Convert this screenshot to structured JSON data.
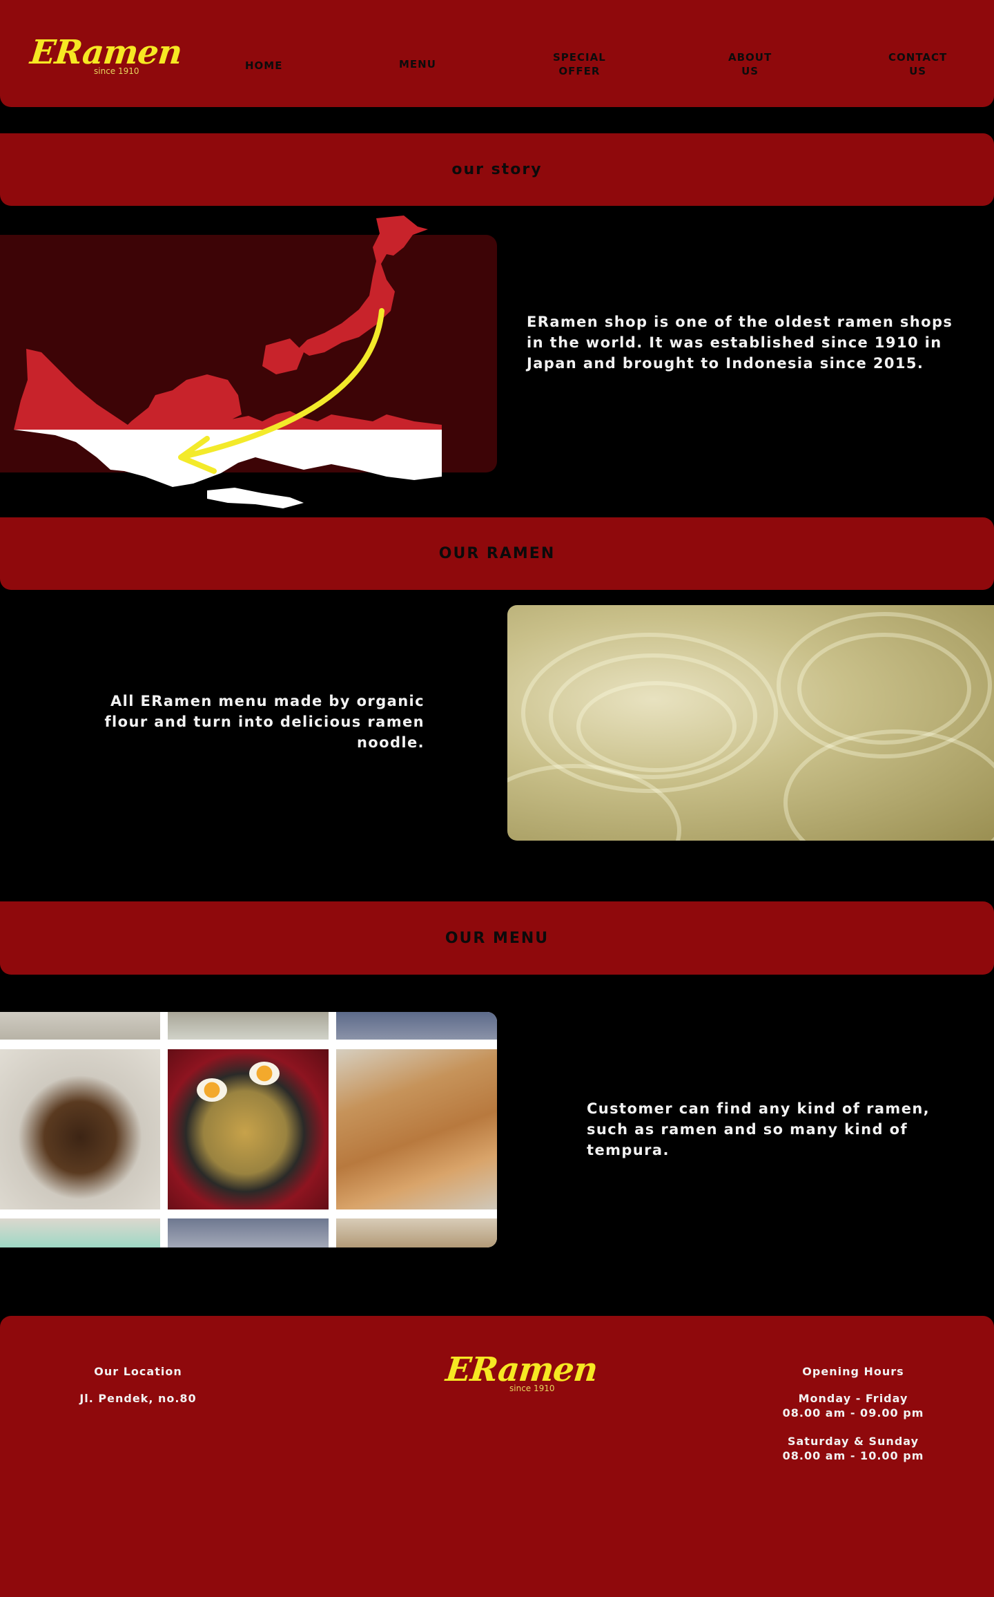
{
  "brand": {
    "logo": "ERamen",
    "since": "since 1910"
  },
  "nav": {
    "home": "HOME",
    "menu": "MENU",
    "special_offer_l1": "SPECIAL",
    "special_offer_l2": "OFFER",
    "about_l1": "ABOUT",
    "about_l2": "US",
    "contact_l1": "CONTACT",
    "contact_l2": "US"
  },
  "story": {
    "heading": "our story",
    "text": "ERamen shop is one of the oldest ramen shops in the world. It was established since 1910 in Japan and brought to Indonesia since 2015."
  },
  "ramen": {
    "heading": "OUR RAMEN",
    "text": "All ERamen menu made by organic flour and turn into delicious ramen noodle."
  },
  "menu": {
    "heading": "OUR MENU",
    "text": "Customer can find any kind of ramen, such as ramen and so many kind of tempura."
  },
  "footer": {
    "location_title": "Our Location",
    "location_address": "Jl. Pendek, no.80",
    "hours_title": "Opening Hours",
    "weekday_days": "Monday - Friday",
    "weekday_hours": "08.00 am - 09.00 pm",
    "weekend_days": "Saturday & Sunday",
    "weekend_hours": "08.00 am - 10.00 pm"
  },
  "colors": {
    "red": "#8f090c",
    "dark_red": "#3d0406",
    "logo_yellow": "#f6e823",
    "arrow_yellow": "#f3ea2a"
  }
}
